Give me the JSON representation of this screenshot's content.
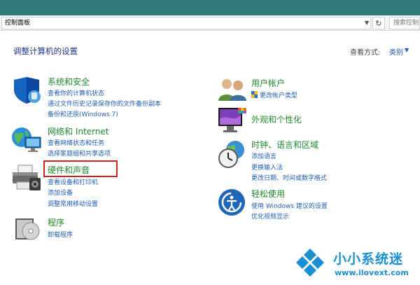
{
  "address_bar": {
    "path": "控制面板",
    "search_placeholder": "搜索控制面板"
  },
  "header": {
    "title": "调整计算机的设置",
    "view_by_label": "查看方式:",
    "view_by_value": "类别"
  },
  "categories": {
    "system_security": {
      "title": "系统和安全",
      "links": [
        "查看你的计算机状态",
        "通过文件历史记录保存你的文件备份副本",
        "备份和还原(Windows 7)"
      ]
    },
    "network": {
      "title": "网络和 Internet",
      "links": [
        "查看网络状态和任务",
        "选择家庭组和共享选项"
      ]
    },
    "hardware": {
      "title": "硬件和声音",
      "links": [
        "查看设备和打印机",
        "添加设备",
        "调整常用移动设置"
      ]
    },
    "programs": {
      "title": "程序",
      "links": [
        "卸载程序"
      ]
    },
    "user_accounts": {
      "title": "用户帐户",
      "links": [
        "更改帐户类型"
      ]
    },
    "appearance": {
      "title": "外观和个性化",
      "links": []
    },
    "clock_region": {
      "title": "时钟、语言和区域",
      "links": [
        "添加语言",
        "更换输入法",
        "更改日期、时间或数字格式"
      ]
    },
    "ease_of_access": {
      "title": "轻松使用",
      "links": [
        "使用 Windows 建议的设置",
        "优化视频显示"
      ]
    }
  },
  "watermark": {
    "name": "小小系统迷",
    "url": "www.ilovext.com"
  },
  "colors": {
    "titlebar": "#2e7a78",
    "category_title": "#1e8a2f",
    "link": "#1f5fb3",
    "highlight": "#d21f1f",
    "watermark": "#1b8fd6"
  }
}
